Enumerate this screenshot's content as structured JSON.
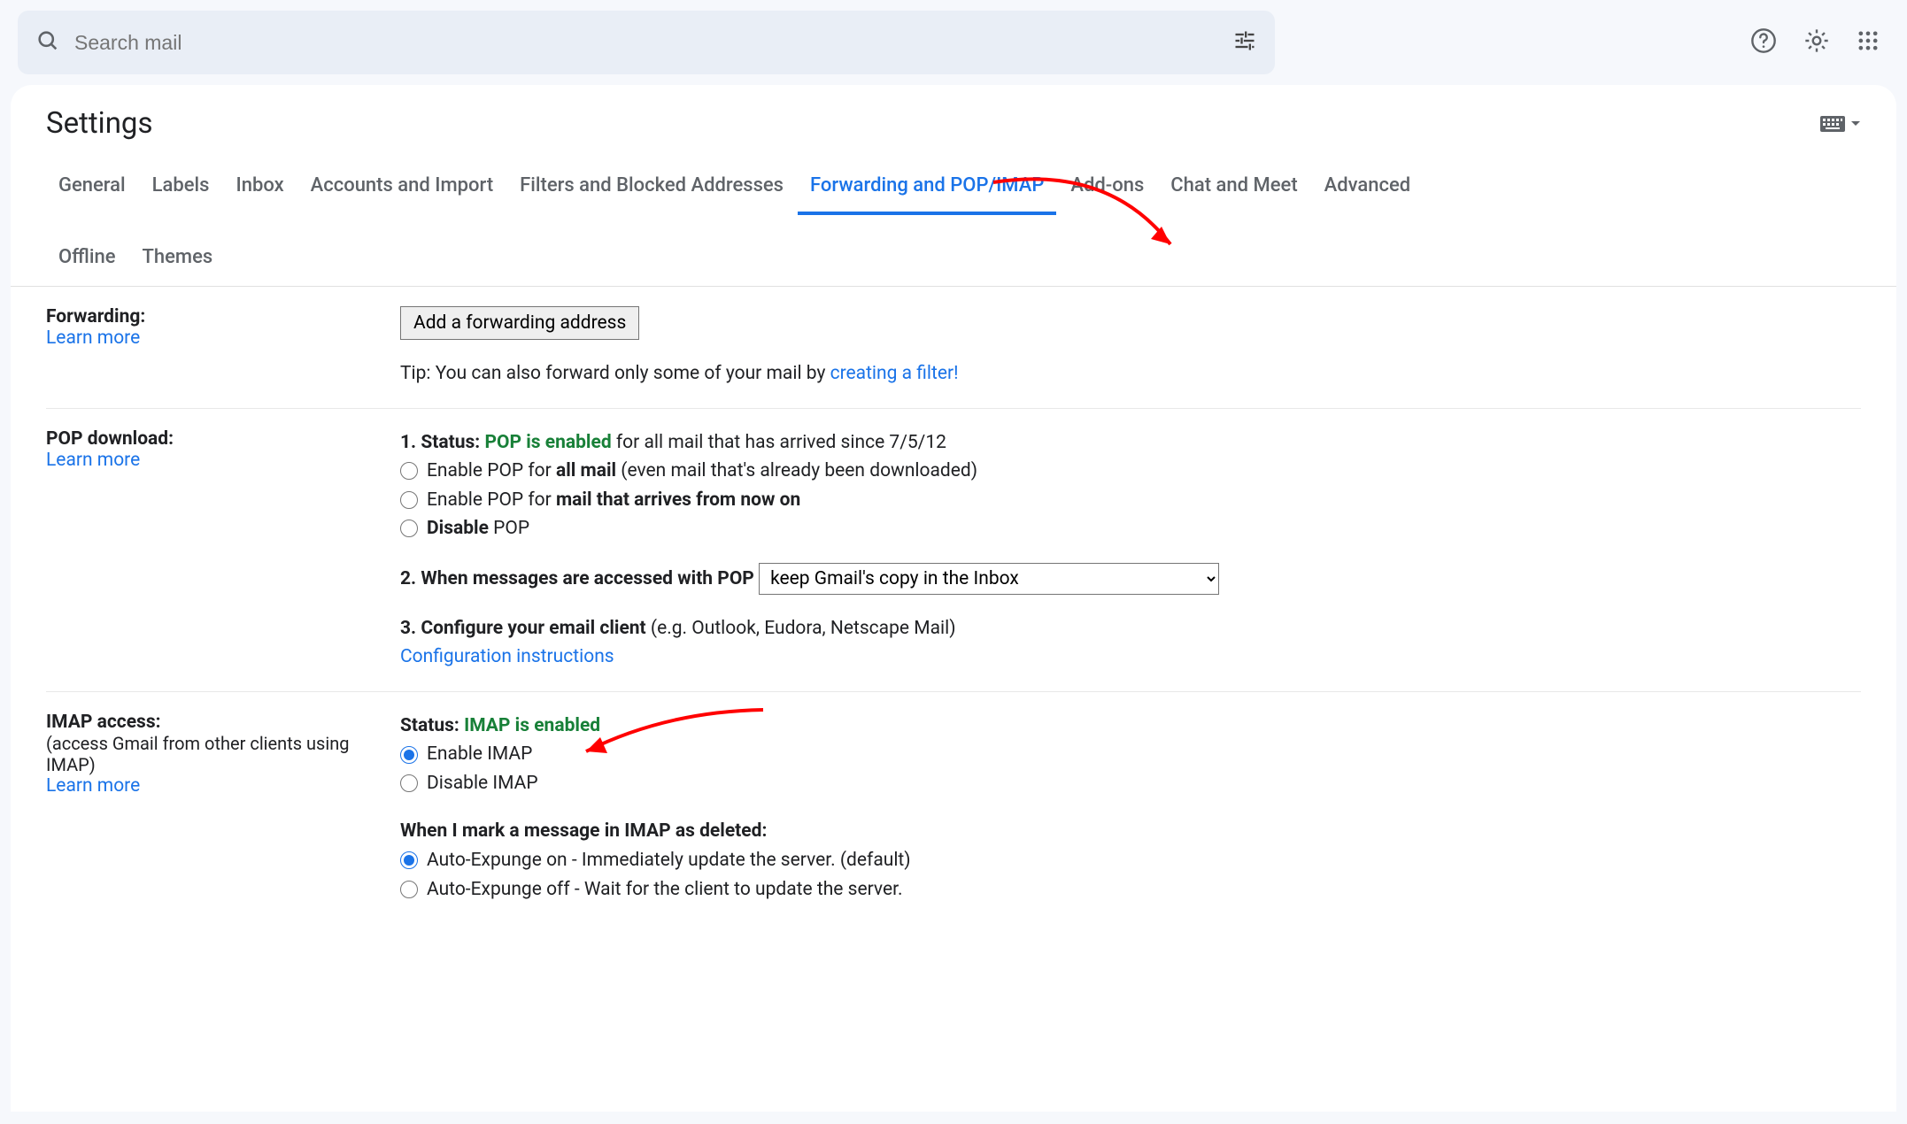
{
  "search": {
    "placeholder": "Search mail"
  },
  "page": {
    "title": "Settings"
  },
  "tabs": [
    "General",
    "Labels",
    "Inbox",
    "Accounts and Import",
    "Filters and Blocked Addresses",
    "Forwarding and POP/IMAP",
    "Add-ons",
    "Chat and Meet",
    "Advanced",
    "Offline",
    "Themes"
  ],
  "forwarding": {
    "heading": "Forwarding:",
    "learn_more": "Learn more",
    "add_button": "Add a forwarding address",
    "tip_prefix": "Tip: You can also forward only some of your mail by ",
    "tip_link": "creating a filter!"
  },
  "pop": {
    "heading": "POP download:",
    "learn_more": "Learn more",
    "status_label": "1. Status: ",
    "status_value": "POP is enabled",
    "status_suffix": " for all mail that has arrived since 7/5/12",
    "opt_all_pre": "Enable POP for ",
    "opt_all_bold": "all mail",
    "opt_all_post": " (even mail that's already been downloaded)",
    "opt_now_pre": "Enable POP for ",
    "opt_now_bold": "mail that arrives from now on",
    "opt_disable_bold": "Disable",
    "opt_disable_post": " POP",
    "step2_label": "2. When messages are accessed with POP",
    "step2_select": "keep Gmail's copy in the Inbox",
    "step3_label": "3. Configure your email client ",
    "step3_suffix": "(e.g. Outlook, Eudora, Netscape Mail)",
    "config_link": "Configuration instructions"
  },
  "imap": {
    "heading": "IMAP access:",
    "subtext": "(access Gmail from other clients using IMAP)",
    "learn_more": "Learn more",
    "status_label": "Status: ",
    "status_value": "IMAP is enabled",
    "opt_enable": "Enable IMAP",
    "opt_disable": "Disable IMAP",
    "deleted_heading": "When I mark a message in IMAP as deleted:",
    "expunge_on": "Auto-Expunge on - Immediately update the server. (default)",
    "expunge_off": "Auto-Expunge off - Wait for the client to update the server."
  }
}
